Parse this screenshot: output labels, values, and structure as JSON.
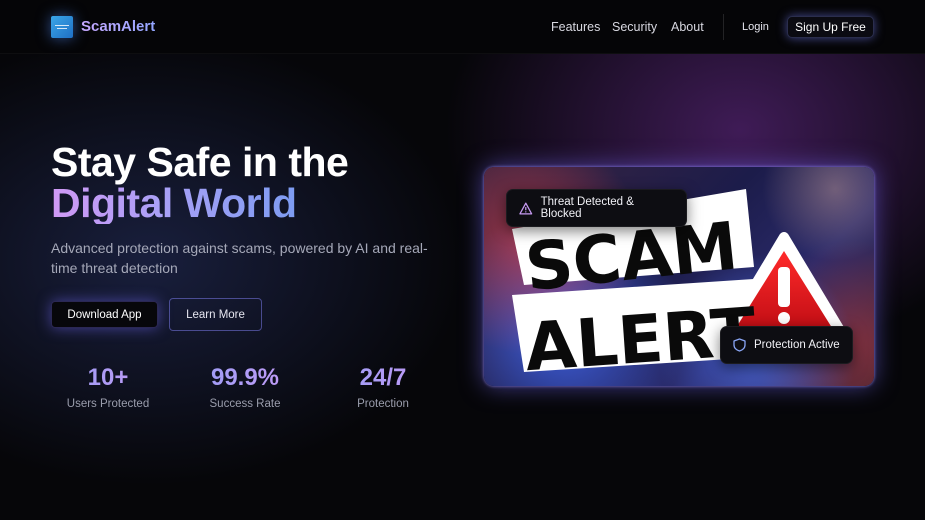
{
  "nav": {
    "brand": "ScamAlert",
    "links": [
      "Features",
      "Security",
      "About"
    ],
    "login": "Login",
    "signup": "Sign Up Free"
  },
  "hero": {
    "title_line1": "Stay Safe in the",
    "title_line2": "Digital World",
    "subtitle": "Advanced protection against scams, powered by AI and real-time threat detection",
    "primary_button": "Download App",
    "secondary_button": "Learn More"
  },
  "stats": [
    {
      "value": "10+",
      "label": "Users Protected"
    },
    {
      "value": "99.9%",
      "label": "Success Rate"
    },
    {
      "value": "24/7",
      "label": "Protection"
    }
  ],
  "card": {
    "image_text_line1": "SCAM",
    "image_text_line2": "ALERT",
    "badge_top": "Threat Detected & Blocked",
    "badge_bottom": "Protection Active"
  },
  "colors": {
    "accent_purple": "#b49cf6",
    "accent_blue": "#7d9cf2",
    "background": "#060609",
    "warning_red": "#e0141e"
  },
  "icons": {
    "logo": "shield-logo-icon",
    "threat": "warning-triangle-icon",
    "protection": "shield-icon"
  }
}
